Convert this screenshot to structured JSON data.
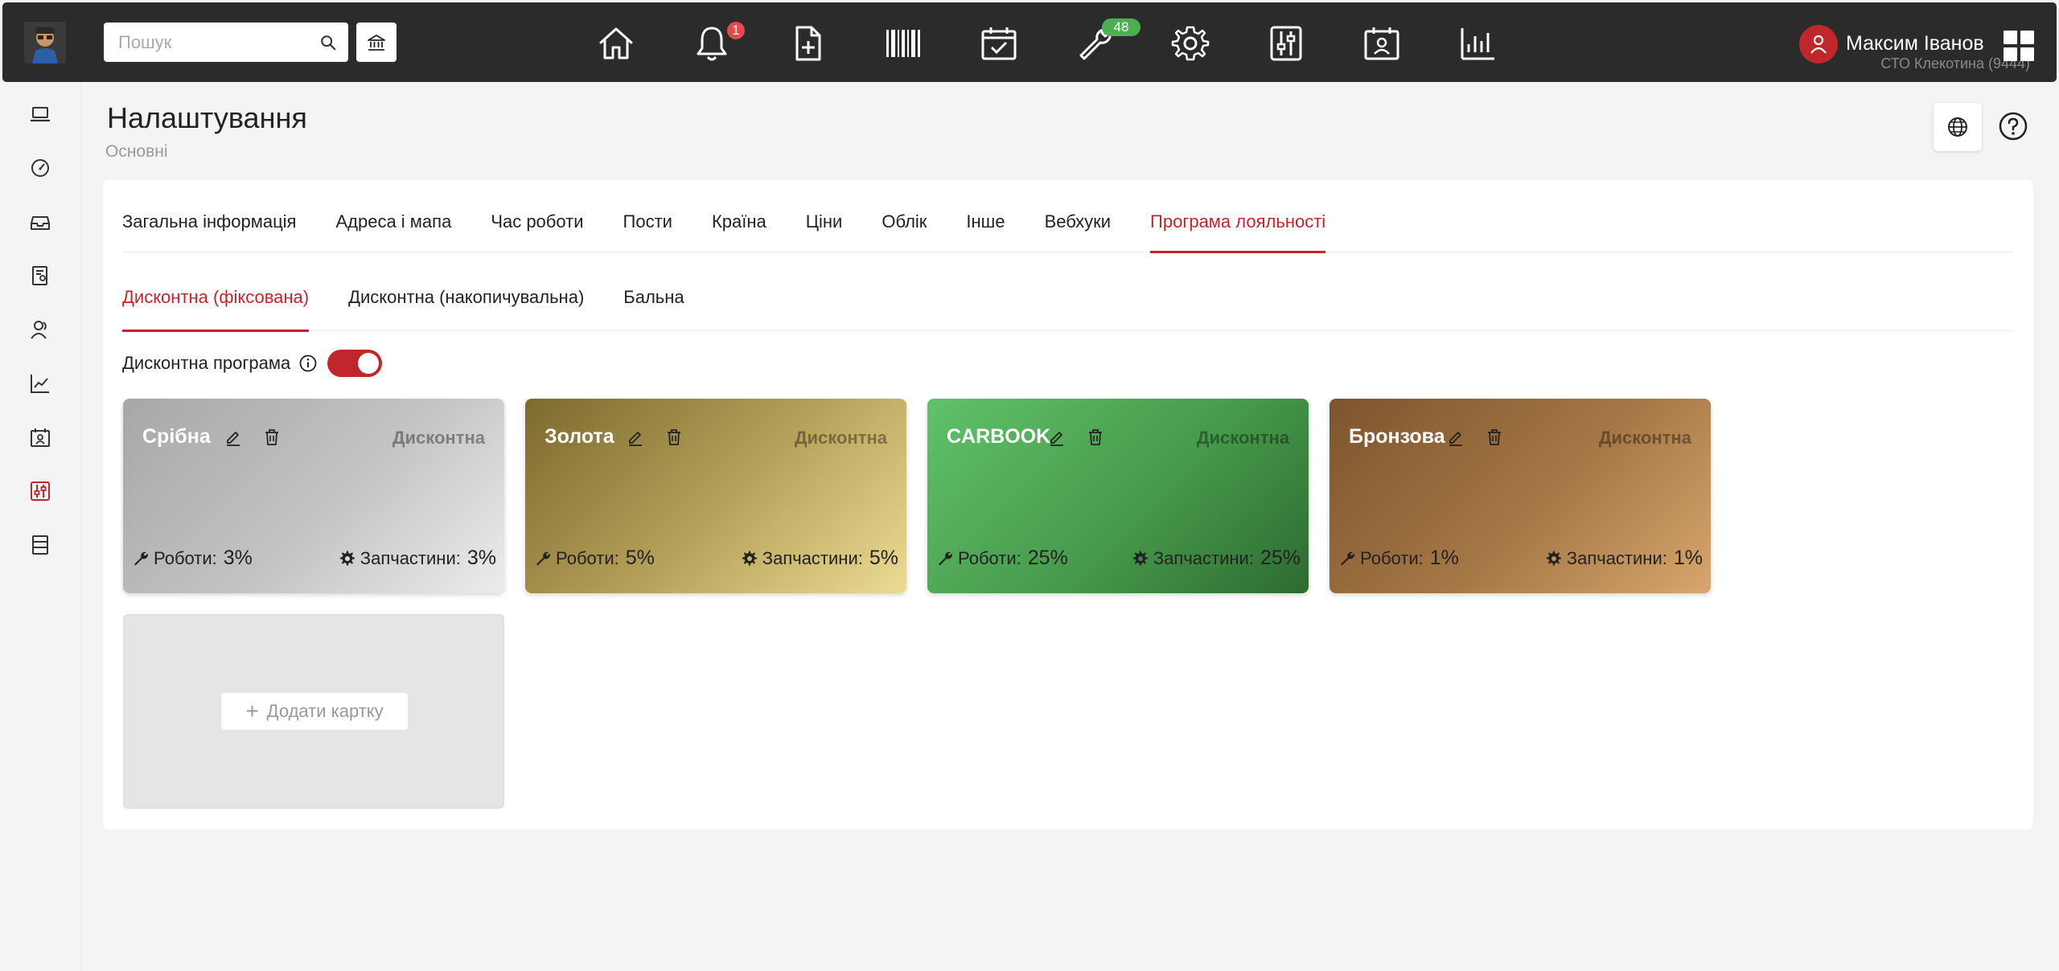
{
  "header": {
    "search_placeholder": "Пошук",
    "notifications_count": "1",
    "tasks_count": "48",
    "user_name": "Максим Іванов",
    "user_org": "СТО Клекотина (9444)",
    "nav_icons": [
      "home-icon",
      "bell-icon",
      "add-document-icon",
      "barcode-icon",
      "calendar-check-icon",
      "wrench-icon",
      "gear-icon",
      "sliders-icon",
      "calendar-person-icon",
      "bar-chart-icon"
    ]
  },
  "sidebar": {
    "icons": [
      "laptop-icon",
      "speedometer-icon",
      "inbox-icon",
      "document-person-icon",
      "people-icon",
      "line-chart-icon",
      "calendar-person-icon",
      "sliders-icon",
      "list-icon"
    ],
    "active": "sliders-icon"
  },
  "page": {
    "title": "Налаштування",
    "subtitle": "Основні"
  },
  "tabs": [
    {
      "label": "Загальна інформація",
      "active": false
    },
    {
      "label": "Адреса і мапа",
      "active": false
    },
    {
      "label": "Час роботи",
      "active": false
    },
    {
      "label": "Пости",
      "active": false
    },
    {
      "label": "Країна",
      "active": false
    },
    {
      "label": "Ціни",
      "active": false
    },
    {
      "label": "Облік",
      "active": false
    },
    {
      "label": "Інше",
      "active": false
    },
    {
      "label": "Вебхуки",
      "active": false
    },
    {
      "label": "Програма лояльності",
      "active": true
    }
  ],
  "subtabs": [
    {
      "label": "Дисконтна (фіксована)",
      "active": true
    },
    {
      "label": "Дисконтна (накопичувальна)",
      "active": false
    },
    {
      "label": "Бальна",
      "active": false
    }
  ],
  "program": {
    "label": "Дисконтна програма",
    "enabled": true
  },
  "cards": [
    {
      "name": "Срібна",
      "type": "Дисконтна",
      "works_label": "Роботи:",
      "works_pct": "3%",
      "parts_label": "Запчастини:",
      "parts_pct": "3%",
      "style": "silver"
    },
    {
      "name": "Золота",
      "type": "Дисконтна",
      "works_label": "Роботи:",
      "works_pct": "5%",
      "parts_label": "Запчастини:",
      "parts_pct": "5%",
      "style": "gold"
    },
    {
      "name": "CARBOOK",
      "type": "Дисконтна",
      "works_label": "Роботи:",
      "works_pct": "25%",
      "parts_label": "Запчастини:",
      "parts_pct": "25%",
      "style": "carbook"
    },
    {
      "name": "Бронзова",
      "type": "Дисконтна",
      "works_label": "Роботи:",
      "works_pct": "1%",
      "parts_label": "Запчастини:",
      "parts_pct": "1%",
      "style": "bronze"
    }
  ],
  "add_card": {
    "label": "Додати картку"
  },
  "colors": {
    "accent": "#c0272d",
    "topbar": "#2b2b2b",
    "badge_red": "#e34b4b",
    "badge_green": "#4caf50"
  }
}
